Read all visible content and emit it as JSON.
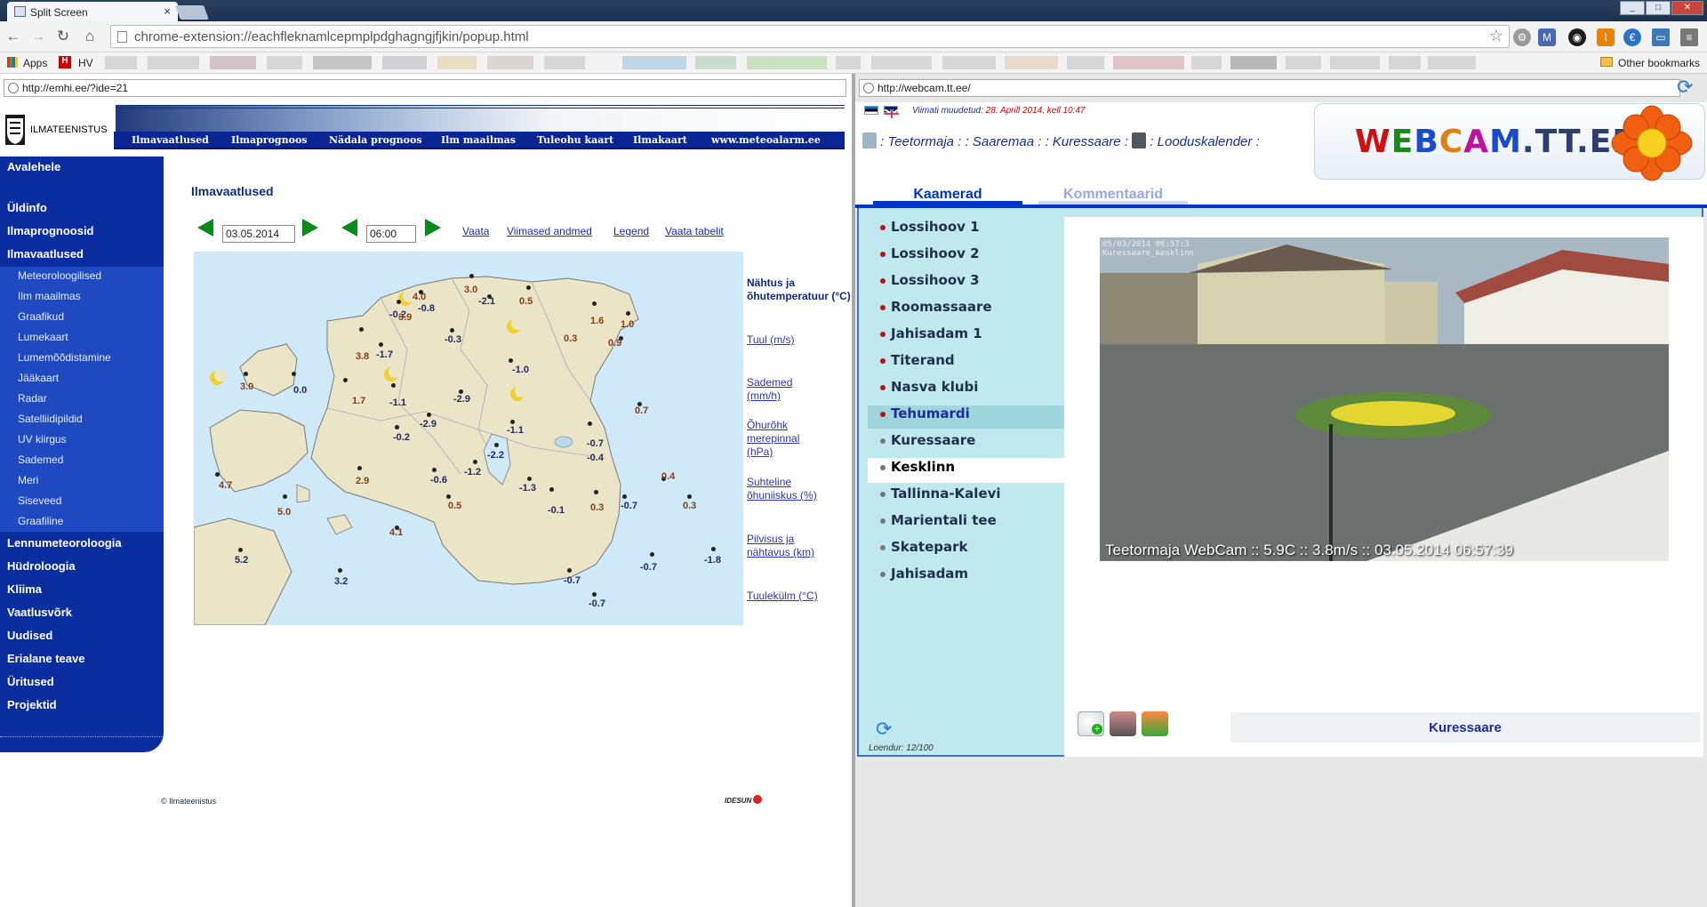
{
  "browser": {
    "tab_title": "Split Screen",
    "url": "chrome-extension://eachfleknamlcepmplpdghagngjfjkin/popup.html",
    "bookmarks": {
      "apps": "Apps",
      "hv": "HV",
      "other": "Other bookmarks"
    },
    "window_controls": {
      "minimize": "_",
      "maximize": "□",
      "close": "✕"
    }
  },
  "left_pane": {
    "url": "http://emhi.ee/?ide=21",
    "site": {
      "brand": "ILMATEENISTUS",
      "nav": [
        "Ilmavaatlused",
        "Ilmaprognoos",
        "Nädala prognoos",
        "Ilm maailmas",
        "Tuleohu kaart",
        "Ilmakaart",
        "www.meteoalarm.ee"
      ],
      "sidebar_main_top": [
        "Avalehele",
        "Üldinfo",
        "Ilmaprognoosid",
        "Ilmavaatlused"
      ],
      "sidebar_sub": [
        "Meteoroloogilised",
        "Ilm maailmas",
        "Graafikud",
        "Lumekaart",
        "Lumemõõdistamine",
        "Jääkaart",
        "Radar",
        "Satelliidipildid",
        "UV kiirgus",
        "Sademed",
        "Meri",
        "Siseveed",
        "Graafiline"
      ],
      "sidebar_main_bottom": [
        "Lennumeteoroloogia",
        "Hüdroloogia",
        "Kliima",
        "Vaatlusvõrk",
        "Uudised",
        "Erialane teave",
        "Üritused",
        "Projektid"
      ],
      "page_title": "Ilmavaatlused",
      "date_value": "03.05.2014",
      "time_value": "06:00",
      "links": [
        "Vaata",
        "Viimased andmed",
        "Legend",
        "Vaata tabelit"
      ],
      "legend_title": "Nähtus ja õhutemperatuur (°C)",
      "legend_links": [
        "Tuul (m/s)",
        "Sademed (mm/h)",
        "Õhurõhk merepinnal (hPa)",
        "Suhteline õhuniiskus (%)",
        "Pilvisus ja nähtavus (km)",
        "Tuulekülm (°C)"
      ],
      "temps": [
        "4.0",
        "-0.8",
        "-0.2",
        "3.9",
        "3.0",
        "-2.1",
        "0.5",
        "1.6",
        "1.0",
        "0.3",
        "0.9",
        "3.8",
        "-1.7",
        "-0.3",
        "-1.0",
        "3.0",
        "0.0",
        "1.7",
        "-1.1",
        "-2.9",
        "-2.9",
        "-0.2",
        "-1.1",
        "-0.7",
        "-0.4",
        "0.7",
        "2.9",
        "-0.6",
        "-1.2",
        "-2.2",
        "-1.3",
        "0.4",
        "4.7",
        "0.5",
        "-0.1",
        "0.3",
        "-0.7",
        "0.3",
        "5.0",
        "4.1",
        "-1.8",
        "-0.7",
        "5.2",
        "3.2",
        "-0.7",
        "-0.7"
      ],
      "footer": "© Ilmateenistus",
      "credit": "IDESUN"
    }
  },
  "right_pane": {
    "url": "http://webcam.tt.ee/",
    "modified_label": "Viimati muudetud:",
    "modified_date": "28. Aprill 2014, kell 10:47",
    "breadcrumbs": [
      ":  Teetormaja  :",
      ":  Saaremaa  :",
      ":  Kuressaare  :",
      ":  Looduskalender  :"
    ],
    "logo": {
      "part1": "WEBCAM",
      "part2": ".TT.EE"
    },
    "tabs": [
      "Kaamerad",
      "Kommentaarid"
    ],
    "cameras": [
      "Lossihoov 1",
      "Lossihoov 2",
      "Lossihoov 3",
      "Roomassaare",
      "Jahisadam 1",
      "Titerand",
      "Nasva klubi",
      "Tehumardi",
      "Kuressaare",
      "Kesklinn",
      "Tallinna-Kalevi",
      "Marientali tee",
      "Skatepark",
      "Jahisadam"
    ],
    "cam_timestamp": "05/03/2014 06:57:3",
    "cam_name_overlay": "Kuressaare_kesklinn",
    "cam_caption": "Teetormaja WebCam :: 5.9C :: 3.8m/s :: 03.05.2014 06:57:39",
    "counter": "Loendur: 12/100",
    "location": "Kuressaare",
    "colors": {
      "active_tab": "#0033cc",
      "inactive_tab": "#9aa6e8",
      "red_bullet": "#c01010",
      "grey_bullet": "#777777"
    }
  }
}
